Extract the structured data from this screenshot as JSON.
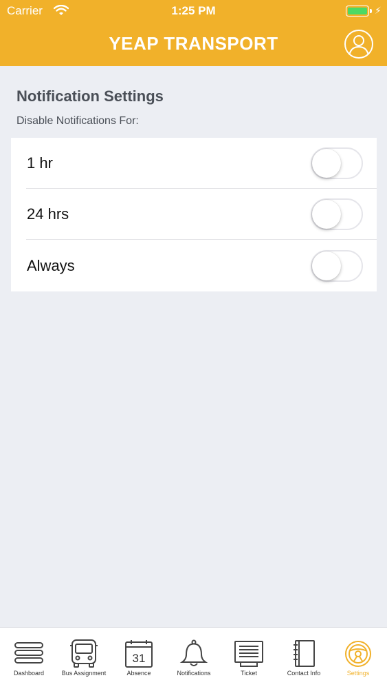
{
  "status_bar": {
    "carrier": "Carrier",
    "time": "1:25 PM"
  },
  "header": {
    "title": "YEAP TRANSPORT",
    "background_color": "#f1b12a"
  },
  "settings": {
    "title": "Notification Settings",
    "subtitle": "Disable Notifications For:",
    "options": [
      {
        "label": "1 hr",
        "enabled": false
      },
      {
        "label": "24 hrs",
        "enabled": false
      },
      {
        "label": "Always",
        "enabled": false
      }
    ]
  },
  "tab_bar": {
    "items": [
      {
        "label": "Dashboard",
        "icon": "menu-icon"
      },
      {
        "label": "Bus Assignment",
        "icon": "bus-icon"
      },
      {
        "label": "Absence",
        "icon": "calendar-icon",
        "icon_text": "31"
      },
      {
        "label": "Notifications",
        "icon": "bell-icon"
      },
      {
        "label": "Ticket",
        "icon": "ticket-icon"
      },
      {
        "label": "Contact Info",
        "icon": "contact-book-icon"
      },
      {
        "label": "Settings",
        "icon": "steering-wheel-icon",
        "active": true
      }
    ],
    "active_color": "#f1b12a"
  }
}
